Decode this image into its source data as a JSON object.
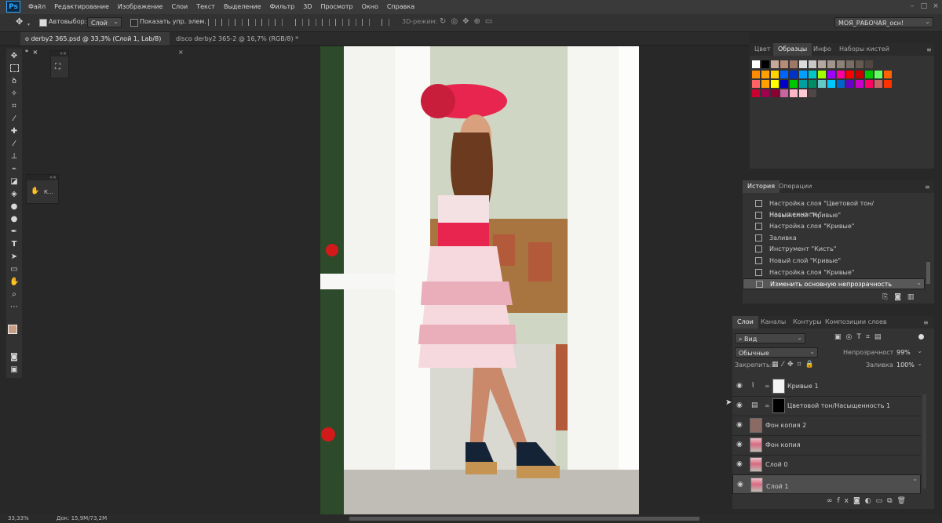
{
  "app": {
    "logo": "Ps"
  },
  "menu": [
    "Файл",
    "Редактирование",
    "Изображение",
    "Слои",
    "Текст",
    "Выделение",
    "Фильтр",
    "3D",
    "Просмотр",
    "Окно",
    "Справка"
  ],
  "window_controls": [
    "–",
    "□",
    "×"
  ],
  "options": {
    "autoselect_label": "Автовыбор:",
    "autoselect_value": "Слой",
    "show_controls_label": "Показать упр. элем.",
    "mode3d_label": "3D-режим:",
    "workspace": "МОЯ_РАБОЧАЯ_осн!"
  },
  "tabs": [
    {
      "label": "o derby2 365.psd @ 33,3% (Слой 1, Lab/8) *",
      "close": "×"
    },
    {
      "label": "disco derby2 365-2 @ 16,7% (RGB/8) *",
      "close": "×"
    }
  ],
  "float_panels": {
    "brush_label": "К..."
  },
  "swatch_panel": {
    "tabs": [
      "Цвет",
      "Образцы",
      "Инфо",
      "Наборы кистей"
    ],
    "active": "Образцы",
    "colors": {
      "row1": [
        "#ffffff",
        "#000000",
        "#c8a89a",
        "#b48c78",
        "#a07868",
        "#dcdcdc",
        "#c8c8c8",
        "#b4a8a0",
        "#a0968c",
        "#8c8278",
        "#786e64",
        "#645a50",
        "#504640"
      ],
      "row2": [
        "#ff8c00",
        "#ffa000",
        "#ffd200",
        "#0064ff",
        "#0032c8",
        "#00a0ff",
        "#00c8c8",
        "#a0ff00",
        "#a000ff",
        "#ff00a0",
        "#ff0000",
        "#c80000",
        "#00c800",
        "#64ff64",
        "#ff6400"
      ],
      "row3": [
        "#ff6464",
        "#ffa000",
        "#ffff00",
        "#0000c8",
        "#00c800",
        "#00a0a0",
        "#008c64",
        "#64c8c8",
        "#00c8ff",
        "#0064c8",
        "#6400c8",
        "#c800c8",
        "#ff0064",
        "#c86464",
        "#ff3200"
      ],
      "row4": [
        "#c80032",
        "#a00050",
        "#8c0032",
        "#c864a0",
        "#ffb4c8",
        "#ffc8d2",
        "#504648"
      ]
    }
  },
  "history_panel": {
    "tabs": [
      "История",
      "Операции"
    ],
    "items": [
      "Настройка слоя \"Цветовой тон/Насыщенность\"",
      "Новый слой \"Кривые\"",
      "Настройка слоя \"Кривые\"",
      "Заливка",
      "Инструмент \"Кисть\"",
      "Новый слой \"Кривые\"",
      "Настройка слоя \"Кривые\"",
      "Изменить основную непрозрачность"
    ]
  },
  "layers_panel": {
    "tabs": [
      "Слои",
      "Каналы",
      "Контуры",
      "Композиции слоев"
    ],
    "filter": "Вид",
    "blend": "Обычные",
    "opacity_label": "Непрозрачность:",
    "opacity": "99%",
    "lock_label": "Закрепить:",
    "fill_label": "Заливка:",
    "fill": "100%",
    "layers": [
      {
        "name": "Кривые 1",
        "kind": "curves"
      },
      {
        "name": "Цветовой тон/Насыщенность 1",
        "kind": "hue"
      },
      {
        "name": "Фон копия 2",
        "kind": "solid"
      },
      {
        "name": "Фон копия",
        "kind": "photo"
      },
      {
        "name": "Слой 0",
        "kind": "photo"
      },
      {
        "name": "Слой 1",
        "kind": "photo"
      }
    ],
    "footer_icons": [
      "link-icon",
      "fx-icon",
      "mask-icon",
      "adjustment-icon",
      "folder-icon",
      "new-layer-icon",
      "trash-icon"
    ]
  },
  "status": {
    "zoom": "33,33%",
    "doc": "Док: 15,9M/73,2M"
  }
}
